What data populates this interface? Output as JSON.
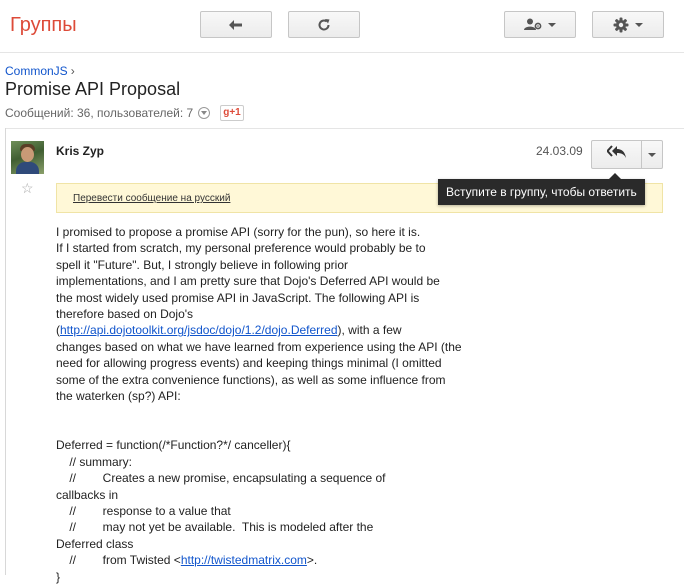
{
  "app": {
    "title": "Группы"
  },
  "toolbar": {
    "back_icon": "back-arrow-icon",
    "refresh_icon": "refresh-icon",
    "users_icon": "user-settings-icon",
    "settings_icon": "gear-icon"
  },
  "breadcrumb": {
    "group": "CommonJS",
    "separator": "›"
  },
  "thread": {
    "title": "Promise API Proposal",
    "stats": "Сообщений: 36, пользователей: 7",
    "gplus_label": "g+1"
  },
  "message": {
    "author": "Kris Zyp",
    "date": "24.03.09",
    "star": "☆",
    "translate_link": "Перевести сообщение на русский",
    "tooltip": "Вступите в группу, чтобы ответить",
    "body": {
      "p1": "I promised to propose a promise API (sorry for the pun), so here it is.\nIf I started from scratch, my personal preference would probably be to\nspell it \"Future\". But, I strongly believe in following prior\nimplementations, and I am pretty sure that Dojo's Deferred API would be\nthe most widely used promise API in JavaScript. The following API is\ntherefore based on Dojo's\n(",
      "link1": "http://api.dojotoolkit.org/jsdoc/dojo/1.2/dojo.Deferred",
      "p2": "), with a few\nchanges based on what we have learned from experience using the API (the\nneed for allowing progress events) and keeping things minimal (I omitted\nsome of the extra convenience functions), as well as some influence from\nthe waterken (sp?) API:\n\n\nDeferred = function(/*Function?*/ canceller){\n    // summary:\n    //        Creates a new promise, encapsulating a sequence of\ncallbacks in\n    //        response to a value that\n    //        may not yet be available.  This is modeled after the\nDeferred class\n    //        from Twisted <",
      "link2": "http://twistedmatrix.com",
      "p3": ">.\n}"
    }
  },
  "colors": {
    "brand": "#dd4b39",
    "link": "#1155cc",
    "tooltip_bg": "#2a2a2a",
    "translate_bg": "#fff8d7"
  }
}
